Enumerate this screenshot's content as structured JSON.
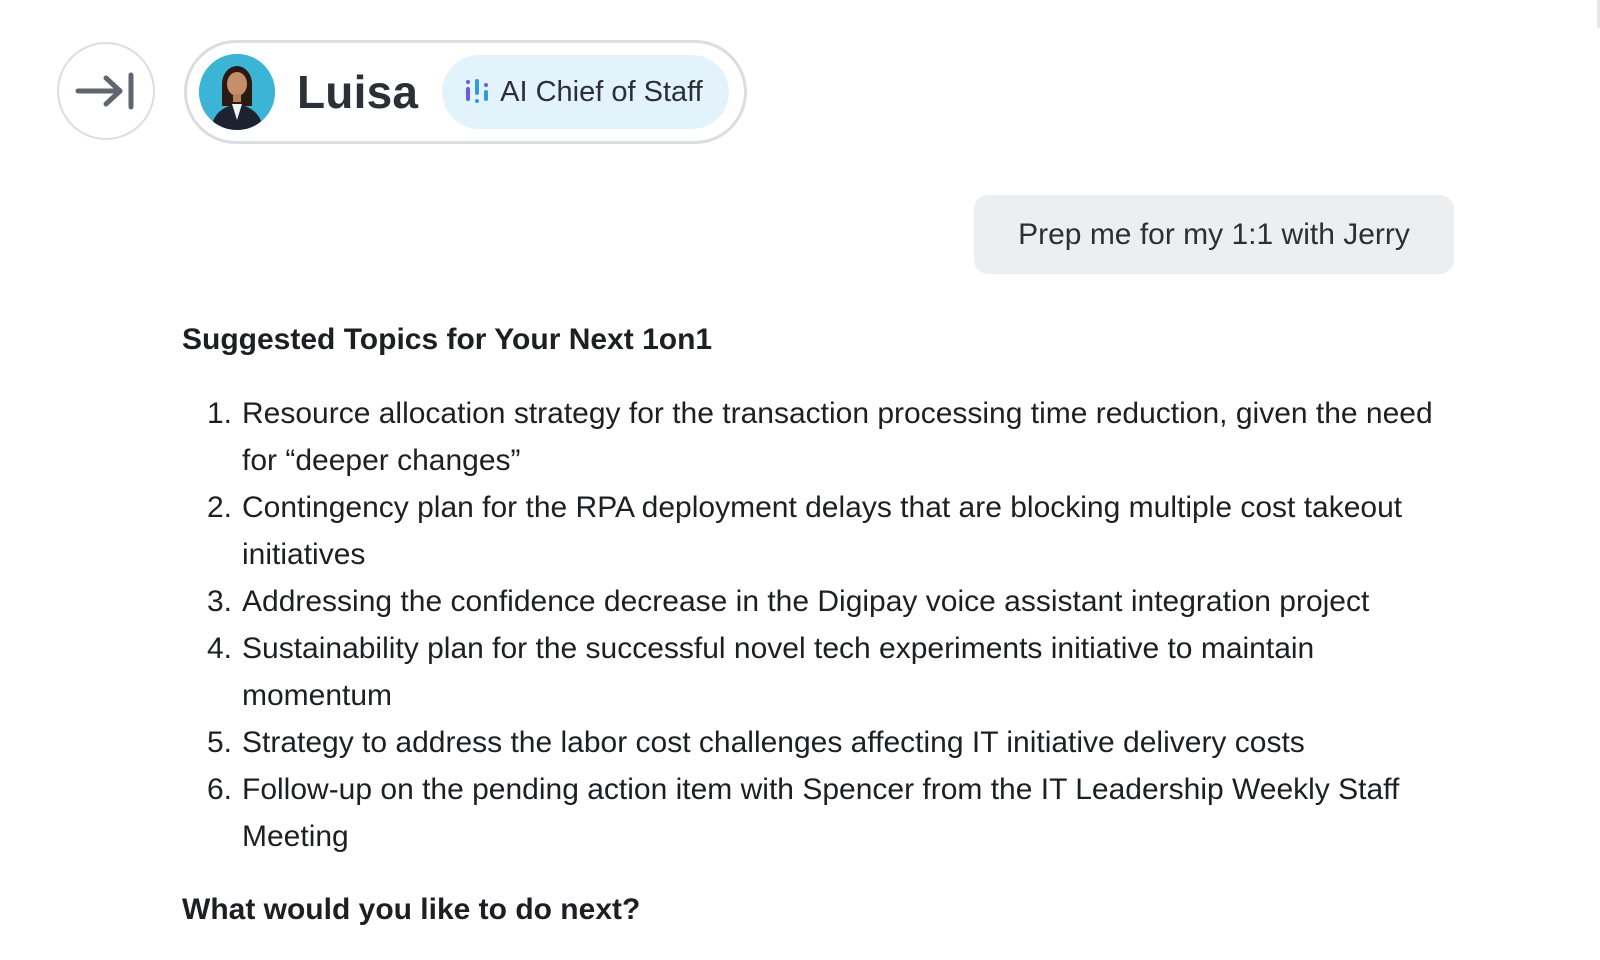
{
  "header": {
    "agent_name": "Luisa",
    "agent_role": "AI Chief of Staff"
  },
  "conversation": {
    "user_message": "Prep me for my 1:1 with Jerry",
    "response": {
      "heading": "Suggested Topics for Your Next 1on1",
      "topics": [
        {
          "num": "1.",
          "text": "Resource allocation strategy for the transaction processing time reduction, given the need for “deeper changes”"
        },
        {
          "num": "2.",
          "text": "Contingency plan for the RPA deployment delays that are blocking multiple cost takeout initiatives"
        },
        {
          "num": "3.",
          "text": "Addressing the confidence decrease in the Digipay voice assistant integration project"
        },
        {
          "num": "4.",
          "text": "Sustainability plan for the successful novel tech experiments initiative to maintain momentum"
        },
        {
          "num": "5.",
          "text": "Strategy to address the labor cost challenges affecting IT initiative delivery costs"
        },
        {
          "num": "6.",
          "text": "Follow-up on the pending action item with Spencer from the IT Leadership Weekly Staff Meeting"
        }
      ],
      "next_prompt": "What would you like to do next?"
    }
  },
  "icons": {
    "collapse": "arrow-right-to-bar-icon",
    "role": "ai-sparkle-bars-icon",
    "avatar": "avatar-photo"
  },
  "colors": {
    "role_badge_bg": "#e3f3fc",
    "user_bubble_bg": "#edeef0",
    "icon_blue": "#2f9be0",
    "icon_purple": "#6b5ce7"
  }
}
